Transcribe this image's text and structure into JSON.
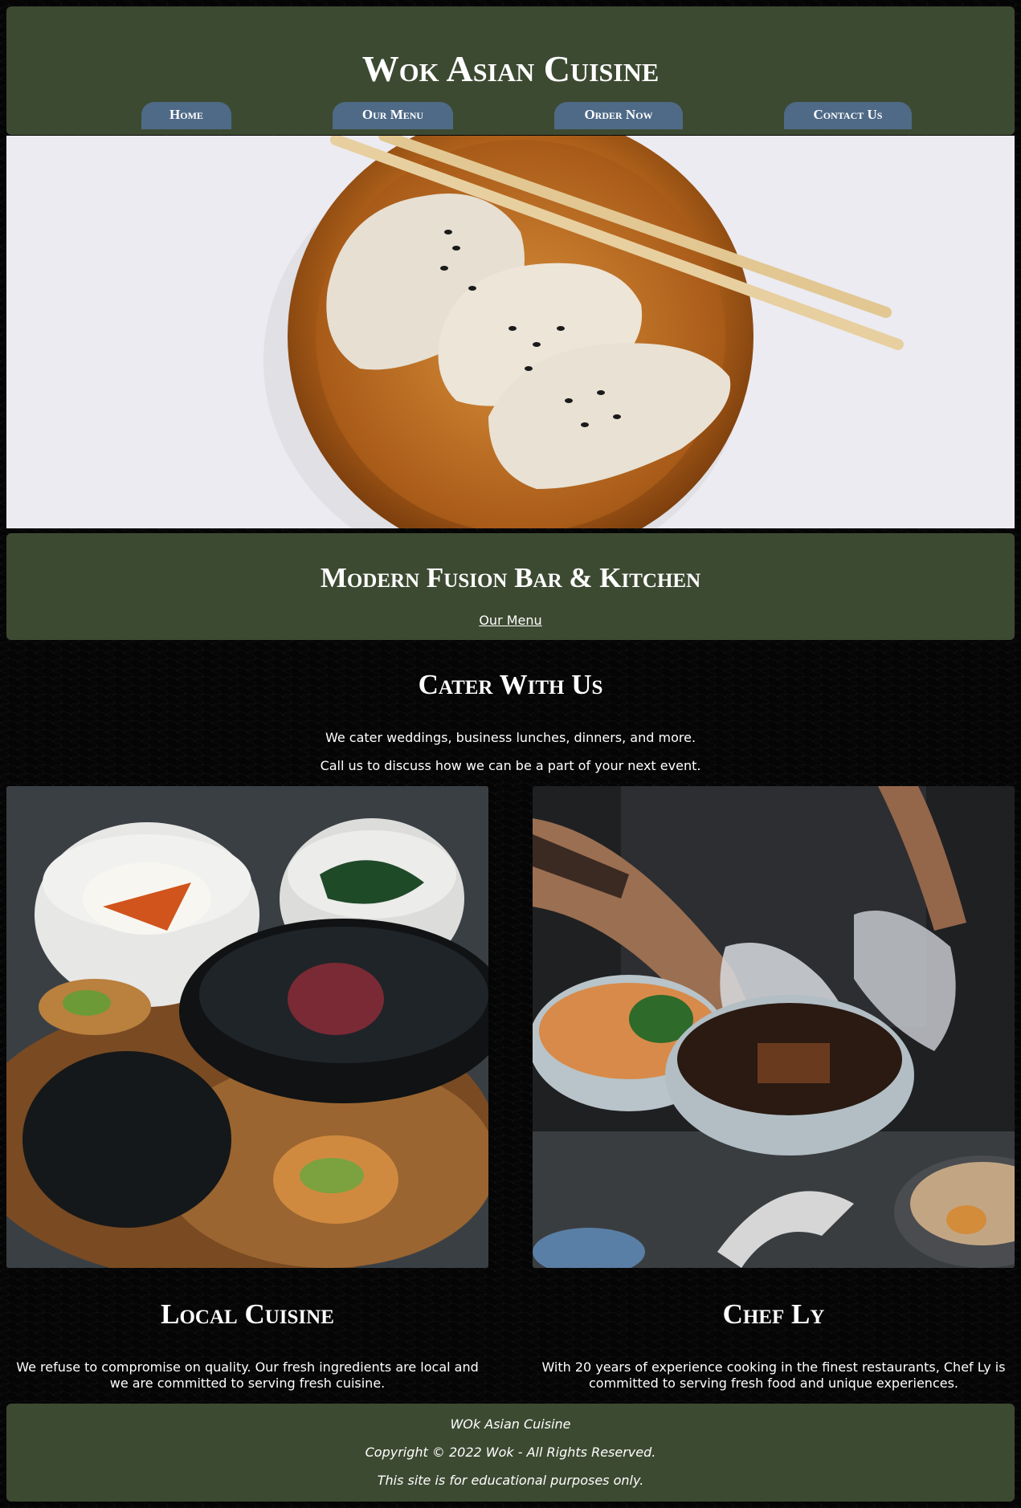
{
  "header": {
    "title": "Wok Asian Cuisine",
    "nav": [
      {
        "label": "Home"
      },
      {
        "label": "Our Menu"
      },
      {
        "label": "Order Now"
      },
      {
        "label": "Contact Us"
      }
    ]
  },
  "hero": {
    "image": "dumplings-on-wooden-plate-with-chopsticks"
  },
  "tagline": {
    "title": "Modern Fusion Bar & Kitchen",
    "link_label": "Our Menu"
  },
  "cater": {
    "title": "Cater With Us",
    "line1": "We cater weddings, business lunches, dinners, and more.",
    "line2": "Call us to discuss how we can be a part of your next event."
  },
  "columns": [
    {
      "image": "rice-bowls-and-teapot",
      "title": "Local Cuisine",
      "text": "We refuse to compromise on quality. Our fresh ingredients are local and we are committed to serving fresh cuisine."
    },
    {
      "image": "chef-preparing-ramen",
      "title": "Chef Ly",
      "text": "With 20 years of experience cooking in the finest restaurants, Chef Ly is committed to serving fresh food and unique experiences."
    }
  ],
  "footer": {
    "name": "WOk Asian Cuisine",
    "copyright": "Copyright © 2022 Wok - All Rights Reserved.",
    "notice": "This site is for educational purposes only."
  },
  "colors": {
    "panel": "#3d4a32",
    "nav_pill": "#4e6a87",
    "background": "#050505",
    "text": "#ffffff"
  }
}
